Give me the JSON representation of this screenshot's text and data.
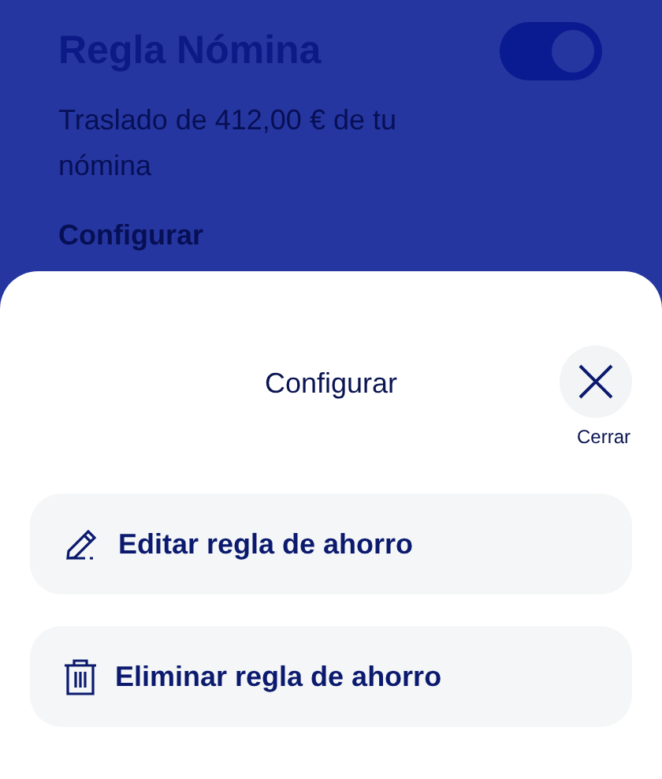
{
  "rule_card": {
    "title": "Regla Nómina",
    "toggle": {
      "on": true
    },
    "description": "Traslado de 412,00 € de tu nómina",
    "link": "Configurar"
  },
  "sheet": {
    "title": "Configurar",
    "close_label": "Cerrar",
    "actions": [
      {
        "kind": "edit",
        "label": "Editar regla de ahorro"
      },
      {
        "kind": "delete",
        "label": "Eliminar regla de ahorro"
      }
    ]
  }
}
